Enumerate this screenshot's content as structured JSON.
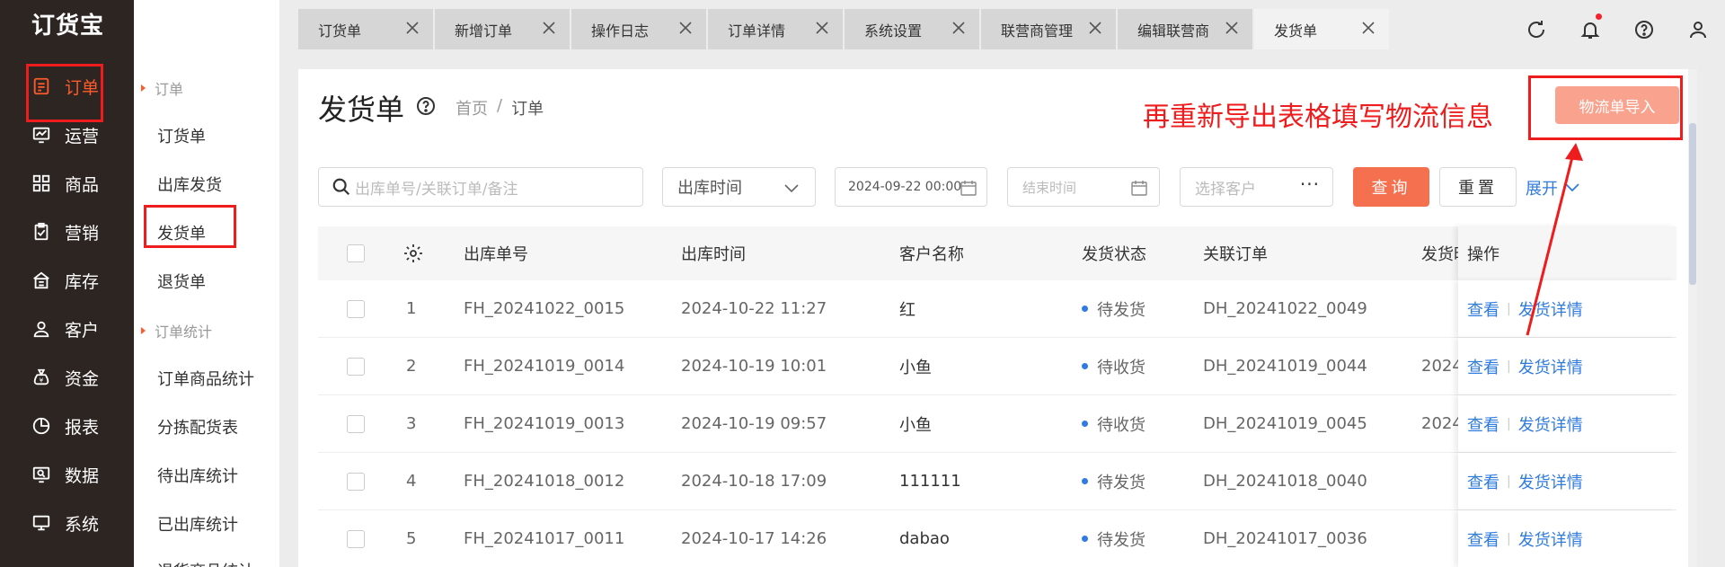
{
  "app": {
    "logo": "订货宝"
  },
  "sidebar": {
    "items": [
      {
        "label": "订单",
        "icon": "order-icon",
        "active": true
      },
      {
        "label": "运营",
        "icon": "chart-line-icon"
      },
      {
        "label": "商品",
        "icon": "grid-icon"
      },
      {
        "label": "营销",
        "icon": "clipboard-check-icon"
      },
      {
        "label": "库存",
        "icon": "warehouse-icon"
      },
      {
        "label": "客户",
        "icon": "user-icon"
      },
      {
        "label": "资金",
        "icon": "money-bag-icon"
      },
      {
        "label": "报表",
        "icon": "pie-chart-icon"
      },
      {
        "label": "数据",
        "icon": "data-screen-icon"
      },
      {
        "label": "系统",
        "icon": "monitor-icon"
      }
    ]
  },
  "subnav": {
    "group1": "订单",
    "items1": [
      "订货单",
      "出库发货",
      "发货单",
      "退货单"
    ],
    "group2": "订单统计",
    "items2": [
      "订单商品统计",
      "分拣配货表",
      "待出库统计",
      "已出库统计",
      "退货商品统计"
    ]
  },
  "tabs": [
    "订货单",
    "新增订单",
    "操作日志",
    "订单详情",
    "系统设置",
    "联营商管理",
    "编辑联营商",
    "发货单"
  ],
  "page": {
    "title": "发货单",
    "breadcrumb": [
      "首页",
      "订单"
    ],
    "annotation": "再重新导出表格填写物流信息",
    "import_button": "物流单导入"
  },
  "filters": {
    "search_placeholder": "出库单号/关联订单/备注",
    "time_type": "出库时间",
    "start_time": "2024-09-22 00:00",
    "end_placeholder": "结束时间",
    "customer_placeholder": "选择客户",
    "query": "查询",
    "reset": "重置",
    "expand": "展开"
  },
  "table": {
    "headers": [
      "出库单号",
      "出库时间",
      "客户名称",
      "发货状态",
      "关联订单",
      "发货时",
      "操作"
    ],
    "rows": [
      {
        "idx": "1",
        "no": "FH_20241022_0015",
        "time": "2024-10-22 11:27",
        "customer": "红",
        "status": "待发货",
        "order": "DH_20241022_0049",
        "ship": ""
      },
      {
        "idx": "2",
        "no": "FH_20241019_0014",
        "time": "2024-10-19 10:01",
        "customer": "小鱼",
        "status": "待收货",
        "order": "DH_20241019_0044",
        "ship": "2024"
      },
      {
        "idx": "3",
        "no": "FH_20241019_0013",
        "time": "2024-10-19 09:57",
        "customer": "小鱼",
        "status": "待收货",
        "order": "DH_20241019_0045",
        "ship": "2024"
      },
      {
        "idx": "4",
        "no": "FH_20241018_0012",
        "time": "2024-10-18 17:09",
        "customer": "111111",
        "status": "待发货",
        "order": "DH_20241018_0040",
        "ship": ""
      },
      {
        "idx": "5",
        "no": "FH_20241017_0011",
        "time": "2024-10-17 14:26",
        "customer": "dabao",
        "status": "待发货",
        "order": "DH_20241017_0036",
        "ship": ""
      }
    ],
    "op_view": "查看",
    "op_detail": "发货详情"
  },
  "colors": {
    "accent": "#ff5a2b",
    "link": "#2f7bdf",
    "annotation": "#ee1c1c",
    "sidebar": "#2d2522"
  }
}
